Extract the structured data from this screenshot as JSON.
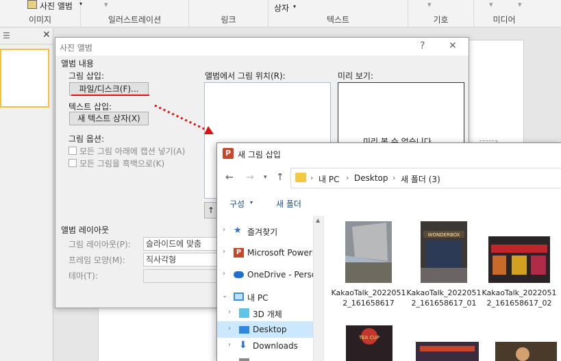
{
  "ribbon": {
    "photo_album_label": "사진 앨범",
    "group_image": "이미지",
    "group_illustrations": "일러스트레이션",
    "group_link": "링크",
    "group_text": "텍스트",
    "group_symbols": "기호",
    "group_media": "미디어",
    "textbox_label": "상자"
  },
  "album_dialog": {
    "title": "사진 앨범",
    "help": "?",
    "close": "✕",
    "album_content": "앨범 내용",
    "insert_picture": "그림 삽입:",
    "file_disk_button": "파일/디스크(F)...",
    "insert_text": "텍스트 삽입:",
    "new_textbox_button": "새 텍스트 상자(X)",
    "picture_options": "그림 옵션:",
    "captions_below": "모든 그림 아래에 캡션 넣기(A)",
    "black_and_white": "모든 그림을 흑백으로(K)",
    "pictures_in_album": "앨범에서 그림 위치(R):",
    "preview": "미리 보기:",
    "preview_unavailable": "미리 볼 수 없습니다.",
    "album_layout": "앨범 레이아웃",
    "picture_layout_label": "그림 레이아웃(P):",
    "picture_layout_value": "슬라이드에 맞춤",
    "frame_shape_label": "프레임 모양(M):",
    "frame_shape_value": "직사각형",
    "theme_label": "테마(T):",
    "theme_value": ""
  },
  "insert_dialog": {
    "title": "새 그림 삽입",
    "breadcrumb": [
      "내 PC",
      "Desktop",
      "새 폴더 (3)"
    ],
    "organize": "구성",
    "new_folder": "새 폴더",
    "nav_items": [
      {
        "label": "즐겨찾기"
      },
      {
        "label": "Microsoft PowerPoint"
      },
      {
        "label": "OneDrive - Personal"
      },
      {
        "label": "내 PC"
      },
      {
        "label": "3D 개체"
      },
      {
        "label": "Desktop"
      },
      {
        "label": "Downloads"
      }
    ],
    "files": [
      {
        "name": "KakaoTalk_20220512_161658617"
      },
      {
        "name": "KakaoTalk_20220512_161658617_01"
      },
      {
        "name": "KakaoTalk_20220512_161658617_02"
      }
    ],
    "thumb_text": "WONDERBOX",
    "thumb_text_2": "TEA CUP"
  },
  "colors": {
    "annotation_red": "#e01010",
    "selection_blue": "#cce8ff",
    "link_blue": "#1a4c8c"
  }
}
